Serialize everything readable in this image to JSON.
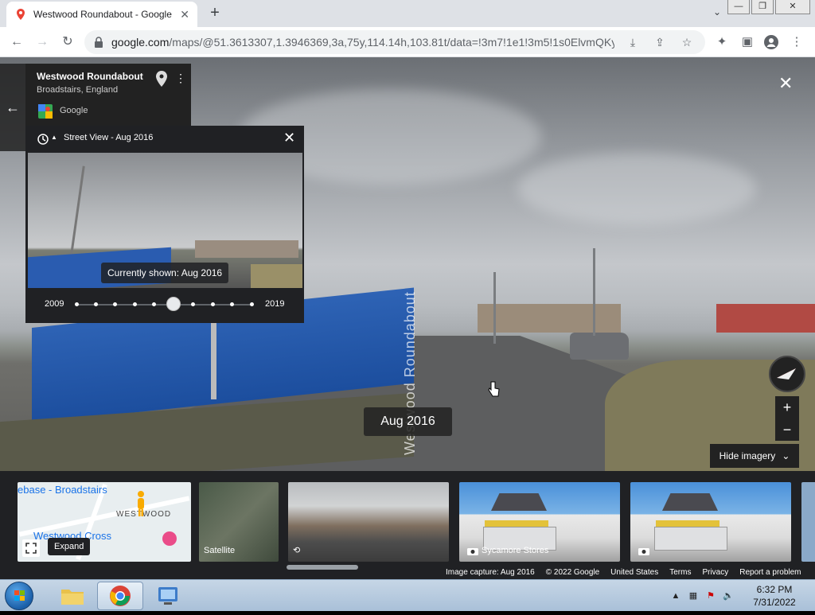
{
  "browser": {
    "tab_title": "Westwood Roundabout - Google Maps",
    "url_host": "google.com",
    "url_path": "/maps/@51.3613307,1.3946369,3a,75y,114.14h,103.81t/data=!3m7!1e1!3m5!1s0ElvmQKyI..."
  },
  "place": {
    "title": "Westwood Roundabout",
    "subtitle": "Broadstairs, England",
    "source": "Google"
  },
  "time_machine": {
    "header": "Street View - Aug 2016",
    "caption": "Currently shown: Aug 2016",
    "year_start": "2009",
    "year_end": "2019",
    "dot_count": 10,
    "selected_index": 5
  },
  "scene": {
    "date_pill": "Aug 2016",
    "road_text": "Westwood Roundabout"
  },
  "controls": {
    "hide_imagery": "Hide imagery",
    "zoom_in": "+",
    "zoom_out": "−"
  },
  "filmstrip": {
    "map_label_1": "ebase - Broadstairs",
    "map_label_2": "Westwood Cross",
    "map_label_3": "WESTWOOD",
    "expand_tooltip": "Expand",
    "satellite_label": "Satellite",
    "store_label_1": "Sycamore Stores"
  },
  "footer": {
    "capture": "Image capture: Aug 2016",
    "copyright": "© 2022 Google",
    "region": "United States",
    "terms": "Terms",
    "privacy": "Privacy",
    "report": "Report a problem"
  },
  "taskbar": {
    "time": "6:32 PM",
    "date": "7/31/2022"
  },
  "colors": {
    "panel_bg": "#202124",
    "accent_blue": "#1a73e8"
  }
}
